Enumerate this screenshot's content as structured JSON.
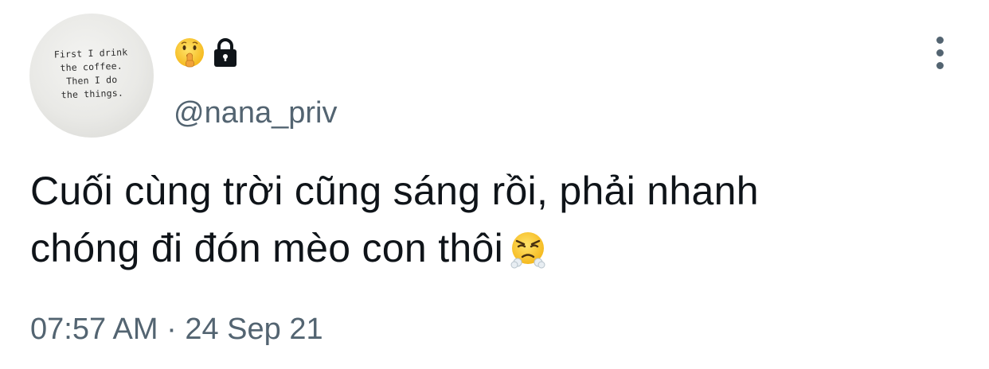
{
  "avatar": {
    "lines": [
      "First I drink",
      "the coffee.",
      "Then I do",
      "the things."
    ]
  },
  "user": {
    "name_icons": [
      "shushing-face-emoji",
      "lock-icon"
    ],
    "handle": "@nana_priv"
  },
  "tweet": {
    "text_line_1": "Cuối cùng trời cũng sáng rồi, phải nhanh",
    "text_line_2": "chóng đi đón mèo con thôi",
    "trailing_emoji": "face-with-steam-from-nose-emoji",
    "time": "07:57 AM",
    "separator": "·",
    "date": "24 Sep 21"
  },
  "colors": {
    "text": "#0f1419",
    "secondary": "#536471",
    "background": "#ffffff"
  }
}
